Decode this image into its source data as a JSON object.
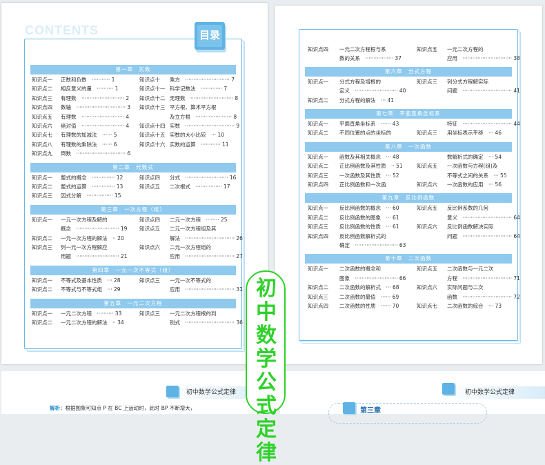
{
  "left_page": {
    "contents_label": "CONTENTS",
    "mulu_label": "目录",
    "chapters": [
      {
        "title": "第一章　实数",
        "rows": [
          {
            "l": [
              "知识点一",
              "正数和负数　··········· 1"
            ],
            "r": [
              "知识点十",
              "乘方　··························· 7"
            ]
          },
          {
            "l": [
              "知识点二",
              "相反意义的量　·········· 1"
            ],
            "r": [
              "知识点十一",
              "科学记数法　············· 7"
            ]
          },
          {
            "l": [
              "知识点三",
              "有理数　·························· 2"
            ],
            "r": [
              "知识点十二",
              "无理数　·························· 8"
            ]
          },
          {
            "l": [
              "知识点四",
              "数轴　······························ 3"
            ],
            "r": [
              "知识点十三",
              "平方根、算术平方根"
            ]
          },
          {
            "l": [
              "知识点五",
              "有理数　·························· 4"
            ],
            "r": [
              "",
              "及立方根　······················ 8"
            ]
          },
          {
            "l": [
              "知识点六",
              "绝对值　·························· 4"
            ],
            "r": [
              "知识点十四",
              "实数　······························ 9"
            ]
          },
          {
            "l": [
              "知识点七",
              "有理数的加减法　······ 5"
            ],
            "r": [
              "知识点十五",
              "实数的大小比较　··· 10"
            ]
          },
          {
            "l": [
              "知识点八",
              "有理数的乘除法　······ 6"
            ],
            "r": [
              "知识点十六",
              "实数的运算　············ 11"
            ]
          },
          {
            "l": [
              "知识点九",
              "倒数　······························ 6"
            ],
            "r": [
              "",
              ""
            ]
          }
        ]
      },
      {
        "title": "第二章　代数式",
        "rows": [
          {
            "l": [
              "知识点一",
              "整式的概念　·············· 12"
            ],
            "r": [
              "知识点四",
              "分式　·························· 16"
            ]
          },
          {
            "l": [
              "知识点二",
              "整式的运算　·············· 13"
            ],
            "r": [
              "知识点五",
              "二次根式　················ 17"
            ]
          },
          {
            "l": [
              "知识点三",
              "因式分解　················ 15"
            ],
            "r": [
              "",
              ""
            ]
          }
        ]
      },
      {
        "title": "第三章　一次方程（组）",
        "rows": [
          {
            "l": [
              "知识点一",
              "一元一次方程及解的"
            ],
            "r": [
              "知识点四",
              "二元一次方程　········ 25"
            ]
          },
          {
            "l": [
              "",
              "概念　·························· 19"
            ],
            "r": [
              "知识点五",
              "二元一次方程组及其"
            ]
          },
          {
            "l": [
              "知识点二",
              "一元一次方程的解法　·· 20"
            ],
            "r": [
              "",
              "解法　······························ 26"
            ]
          },
          {
            "l": [
              "知识点三",
              "列一元一次方程解应"
            ],
            "r": [
              "知识点六",
              "二元一次方程组的"
            ]
          },
          {
            "l": [
              "",
              "用题　·························· 21"
            ],
            "r": [
              "",
              "应用　······························ 27"
            ]
          }
        ]
      },
      {
        "title": "第四章　一元一次不等式（组）",
        "rows": [
          {
            "l": [
              "知识点一",
              "不等式及基本性质　··· 28"
            ],
            "r": [
              "知识点三",
              "一元一次不等式的"
            ]
          },
          {
            "l": [
              "知识点二",
              "不等式与不等式组　··· 29"
            ],
            "r": [
              "",
              "应用　······························ 31"
            ]
          }
        ]
      },
      {
        "title": "第五章　一元二次方程",
        "rows": [
          {
            "l": [
              "知识点一",
              "一元二次方程　·········· 33"
            ],
            "r": [
              "知识点三",
              "一元二次方程根的判"
            ]
          },
          {
            "l": [
              "知识点二",
              "一元二次方程的解法　·· 34"
            ],
            "r": [
              "",
              "别式　······························ 36"
            ]
          }
        ]
      }
    ]
  },
  "right_page": {
    "top_rows": [
      {
        "l": [
          "知识点四",
          "一元二次方程根与系"
        ],
        "r": [
          "知识点五",
          "一元二次方程的"
        ]
      },
      {
        "l": [
          "",
          "数的关系　················· 37"
        ],
        "r": [
          "",
          "应用　······························ 38"
        ]
      }
    ],
    "chapters": [
      {
        "title": "第六章　分式方程",
        "rows": [
          {
            "l": [
              "知识点一",
              "分式方程及增根的"
            ],
            "r": [
              "知识点三",
              "列分式方程解实际"
            ]
          },
          {
            "l": [
              "",
              "定义　·························· 40"
            ],
            "r": [
              "",
              "问题　······························ 41"
            ]
          },
          {
            "l": [
              "知识点二",
              "分式方程的解法　··· 41"
            ],
            "r": [
              "",
              ""
            ]
          }
        ]
      },
      {
        "title": "第七章　平面直角坐标系",
        "rows": [
          {
            "l": [
              "知识点一",
              "平面直角坐标系　······ 43"
            ],
            "r": [
              "",
              "特征　······························ 44"
            ]
          },
          {
            "l": [
              "知识点二",
              "不同位置的点的坐标的"
            ],
            "r": [
              "知识点三",
              "用坐标表示平移　··· 46"
            ]
          }
        ]
      },
      {
        "title": "第八章　一次函数",
        "rows": [
          {
            "l": [
              "知识点一",
              "函数及其相关概念　··· 48"
            ],
            "r": [
              "",
              "数解析式的确定　··· 54"
            ]
          },
          {
            "l": [
              "知识点二",
              "正比例函数及其性质　·· 51"
            ],
            "r": [
              "知识点五",
              "一次函数与方程(组)及"
            ]
          },
          {
            "l": [
              "知识点三",
              "一次函数及其性质　··· 52"
            ],
            "r": [
              "",
              "不等式之间的关系　··· 55"
            ]
          },
          {
            "l": [
              "知识点四",
              "正比例函数和一次函"
            ],
            "r": [
              "知识点六",
              "一次函数的应用　··· 56"
            ]
          }
        ]
      },
      {
        "title": "第九章　反比例函数",
        "rows": [
          {
            "l": [
              "知识点一",
              "反比例函数的概念　··· 60"
            ],
            "r": [
              "知识点五",
              "反比例系数的几何"
            ]
          },
          {
            "l": [
              "知识点二",
              "反比例函数的图象　··· 61"
            ],
            "r": [
              "",
              "意义　······························ 64"
            ]
          },
          {
            "l": [
              "知识点三",
              "反比例函数的性质　··· 61"
            ],
            "r": [
              "知识点六",
              "反比例函数解决实际"
            ]
          },
          {
            "l": [
              "知识点四",
              "反比例函数解析式的"
            ],
            "r": [
              "",
              "问题　······························ 64"
            ]
          },
          {
            "l": [
              "",
              "确定　·························· 63"
            ],
            "r": [
              "",
              ""
            ]
          }
        ]
      },
      {
        "title": "第十章　二次函数",
        "rows": [
          {
            "l": [
              "知识点一",
              "二次函数的概念和"
            ],
            "r": [
              "知识点五",
              "二次函数与一元二次"
            ]
          },
          {
            "l": [
              "",
              "图象　·························· 66"
            ],
            "r": [
              "",
              "方程　······························ 71"
            ]
          },
          {
            "l": [
              "知识点二",
              "二次函数的解析式　··· 68"
            ],
            "r": [
              "知识点六",
              "实际问题与二次"
            ]
          },
          {
            "l": [
              "知识点三",
              "二次函数的最值　······ 69"
            ],
            "r": [
              "",
              "函数　······························ 72"
            ]
          },
          {
            "l": [
              "知识点四",
              "二次函数的性质　······ 70"
            ],
            "r": [
              "知识点七",
              "二次函数的综合　··· 73"
            ]
          }
        ]
      }
    ]
  },
  "banner": {
    "text": "初中数学公式定律"
  },
  "bottom_left": {
    "header": "初中数学公式定律",
    "analysis_label": "解析：",
    "analysis_text": "根据图象可知点 P 在 BC 上运动时，此时 BP 不断增大，"
  },
  "bottom_right": {
    "header": "初中数学公式定律",
    "chapter_label": "第三章"
  },
  "colors": {
    "accent": "#66b8e5",
    "chapter_bar": "#8fcaee",
    "banner_green": "#2fd12a"
  }
}
